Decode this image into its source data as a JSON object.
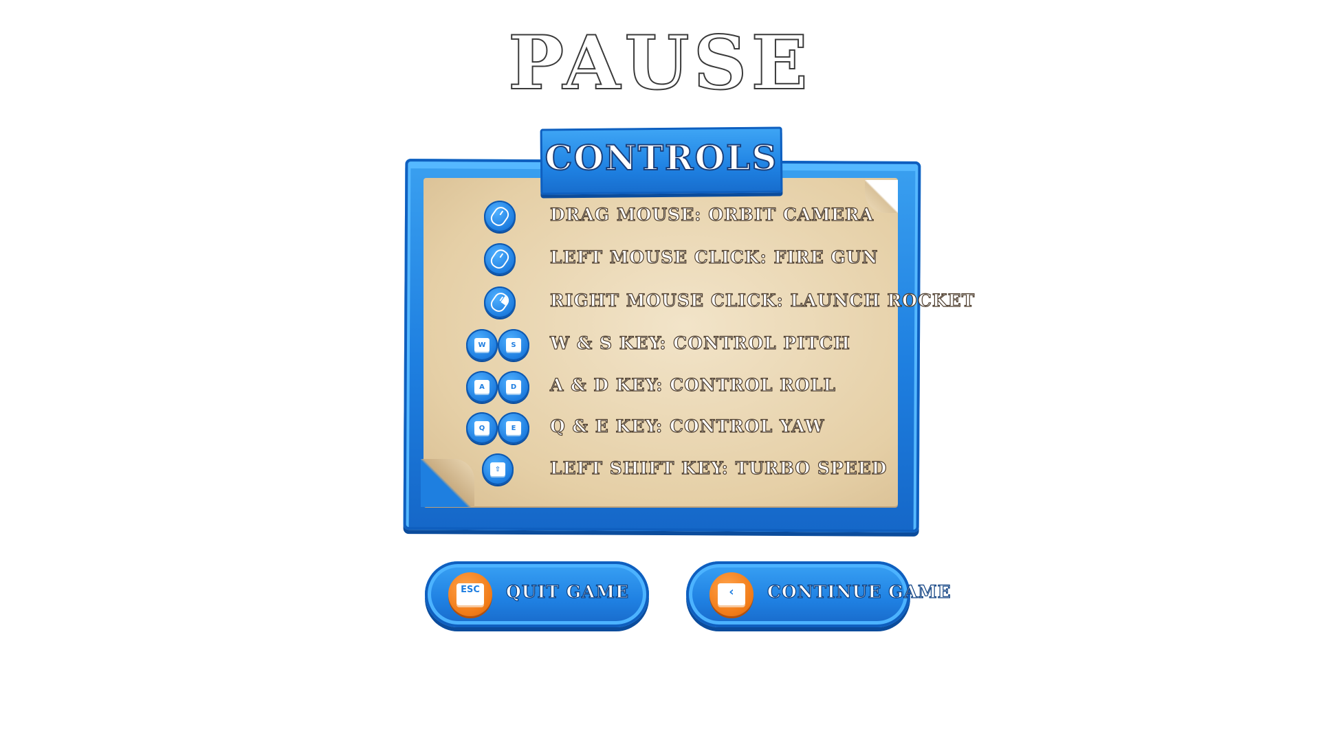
{
  "title": "PAUSE",
  "panel": {
    "title": "CONTROLS",
    "controls": [
      {
        "icon": "mouse-drag-icon",
        "keys": [],
        "label": "DRAG MOUSE: ORBIT CAMERA"
      },
      {
        "icon": "mouse-left-click-icon",
        "keys": [],
        "label": "LEFT MOUSE CLICK: FIRE GUN"
      },
      {
        "icon": "mouse-right-click-icon",
        "keys": [],
        "label": "RIGHT MOUSE CLICK: LAUNCH ROCKET"
      },
      {
        "icon": "key-icon",
        "keys": [
          "W",
          "S"
        ],
        "label": "W & S KEY: CONTROL PITCH"
      },
      {
        "icon": "key-icon",
        "keys": [
          "A",
          "D"
        ],
        "label": "A & D KEY: CONTROL ROLL"
      },
      {
        "icon": "key-icon",
        "keys": [
          "Q",
          "E"
        ],
        "label": "Q & E KEY: CONTROL YAW"
      },
      {
        "icon": "shift-key-icon",
        "keys": [
          "⇧"
        ],
        "label": "LEFT SHIFT KEY: TURBO SPEED"
      }
    ]
  },
  "buttons": {
    "quit": {
      "label": "QUIT GAME",
      "key": "ESC"
    },
    "continue": {
      "label": "CONTINUE GAME",
      "key": "‹"
    }
  },
  "colors": {
    "panel_blue": "#1e7fe0",
    "paper": "#e5cfa6",
    "button_icon_orange": "#f07a16"
  }
}
